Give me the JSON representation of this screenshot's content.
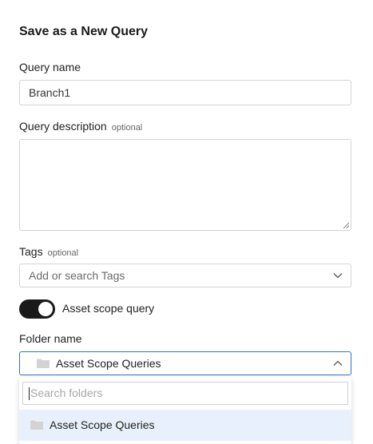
{
  "dialog": {
    "title": "Save as a New Query"
  },
  "query_name": {
    "label": "Query name",
    "value": "Branch1"
  },
  "query_description": {
    "label": "Query description",
    "optional_tag": "optional",
    "value": ""
  },
  "tags": {
    "label": "Tags",
    "optional_tag": "optional",
    "placeholder": "Add or search Tags"
  },
  "asset_scope_toggle": {
    "label": "Asset scope query",
    "state": "on"
  },
  "folder": {
    "label": "Folder name",
    "selected": "Asset Scope Queries",
    "expanded": true,
    "search_placeholder": "Search folders",
    "options": [
      "Asset Scope Queries"
    ]
  },
  "icons": {
    "folder": "folder-icon",
    "chevron_down": "chevron-down-icon",
    "chevron_up": "chevron-up-icon"
  },
  "colors": {
    "toggle_on": "#1a1a1a",
    "focus_border": "#2f6fd0",
    "option_highlight": "#e8f1fb"
  }
}
